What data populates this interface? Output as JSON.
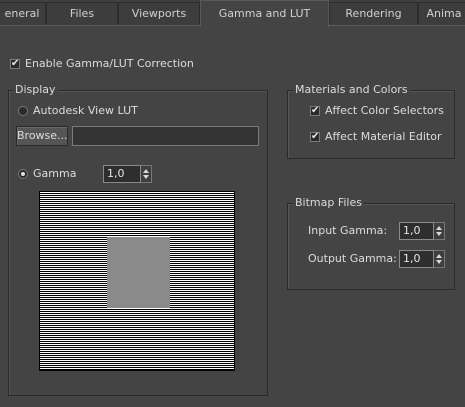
{
  "tabs": [
    {
      "label": "eneral",
      "active": false
    },
    {
      "label": "Files",
      "active": false
    },
    {
      "label": "Viewports",
      "active": false
    },
    {
      "label": "Gamma and LUT",
      "active": true
    },
    {
      "label": "Rendering",
      "active": false
    },
    {
      "label": "Anima",
      "active": false
    }
  ],
  "enable_gamma": {
    "label": "Enable Gamma/LUT Correction",
    "checked": true
  },
  "display": {
    "title": "Display",
    "autodesk_label": "Autodesk View LUT",
    "browse_label": "Browse...",
    "path_value": "",
    "gamma_label": "Gamma",
    "gamma_value": "1,0"
  },
  "materials": {
    "title": "Materials and Colors",
    "affect_color_selectors": {
      "label": "Affect Color Selectors",
      "checked": true
    },
    "affect_material_editor": {
      "label": "Affect Material Editor",
      "checked": true
    }
  },
  "bitmap": {
    "title": "Bitmap Files",
    "input_gamma_label": "Input Gamma:",
    "input_gamma_value": "1,0",
    "output_gamma_label": "Output Gamma:",
    "output_gamma_value": "1,0"
  },
  "icons": {
    "check": "✔"
  }
}
